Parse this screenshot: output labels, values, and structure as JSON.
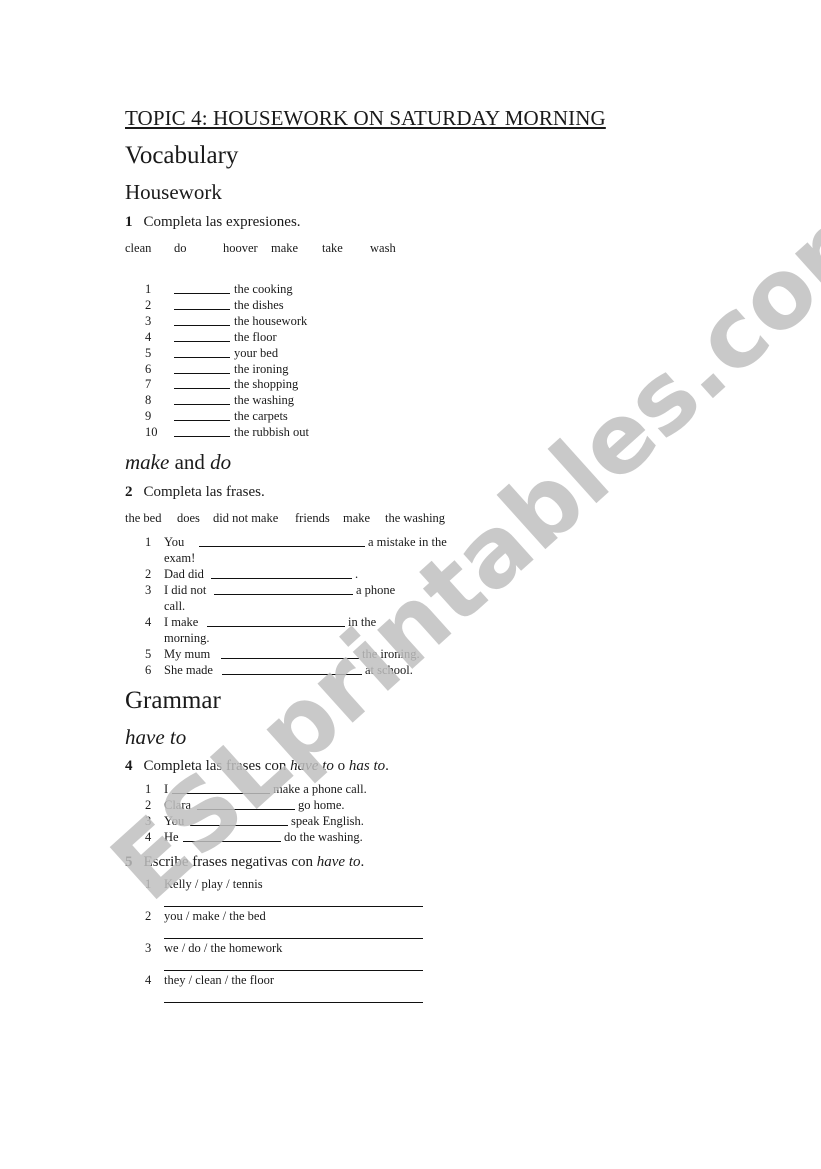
{
  "title": "TOPIC 4: HOUSEWORK ON SATURDAY MORNING",
  "watermark": {
    "text": "ESLprintables.com",
    "color": "#c0c0c0"
  },
  "vocabulary": {
    "heading": "Vocabulary",
    "subheading": "Housework",
    "exercise1": {
      "number": "1",
      "instruction": "Completa las expresiones.",
      "word_bank": [
        "clean",
        "do",
        "hoover",
        "make",
        "take",
        "wash"
      ],
      "items": [
        {
          "n": "1",
          "text": "the cooking"
        },
        {
          "n": "2",
          "text": "the dishes"
        },
        {
          "n": "3",
          "text": "the housework"
        },
        {
          "n": "4",
          "text": "the floor"
        },
        {
          "n": "5",
          "text": "your bed"
        },
        {
          "n": "6",
          "text": "the ironing"
        },
        {
          "n": "7",
          "text": "the shopping"
        },
        {
          "n": "8",
          "text": "the washing"
        },
        {
          "n": "9",
          "text": "the carpets"
        },
        {
          "n": "10",
          "text": "the rubbish out"
        }
      ]
    },
    "make_do": {
      "heading_italic_1": "make",
      "heading_mid": " and ",
      "heading_italic_2": "do"
    },
    "exercise2": {
      "number": "2",
      "instruction": "Completa las frases.",
      "word_bank": [
        "the bed",
        "does",
        "did not make",
        "friends",
        "make",
        "the washing"
      ],
      "items": [
        {
          "n": "1",
          "before": "You",
          "after": "a mistake in the",
          "wrap": "exam!"
        },
        {
          "n": "2",
          "before": "Dad did",
          "after": ".",
          "wrap": ""
        },
        {
          "n": "3",
          "before": "I did not",
          "after": "a phone",
          "wrap": "call."
        },
        {
          "n": "4",
          "before": "I make",
          "after": "in the",
          "wrap": "morning."
        },
        {
          "n": "5",
          "before": "My mum",
          "after": "the ironing.",
          "wrap": ""
        },
        {
          "n": "6",
          "before": "She made",
          "after": "at school.",
          "wrap": ""
        }
      ]
    }
  },
  "grammar": {
    "heading": "Grammar",
    "subheading": "have to",
    "exercise4": {
      "number": "4",
      "instruction_pre": "Completa las frases con ",
      "instruction_i1": "have to",
      "instruction_mid": " o ",
      "instruction_i2": "has to",
      "instruction_end": ".",
      "items": [
        {
          "n": "1",
          "before": "I",
          "after": "make a phone call."
        },
        {
          "n": "2",
          "before": "Clara",
          "after": "go home."
        },
        {
          "n": "3",
          "before": "You",
          "after": "speak English."
        },
        {
          "n": "4",
          "before": "He",
          "after": "do the washing."
        }
      ]
    },
    "exercise5": {
      "number": "5",
      "instruction_pre": "Escribe frases negativas con ",
      "instruction_i": "have to",
      "instruction_end": ".",
      "items": [
        {
          "n": "1",
          "prompt": "Kelly / play / tennis"
        },
        {
          "n": "2",
          "prompt": "you / make / the bed"
        },
        {
          "n": "3",
          "prompt": "we / do / the homework"
        },
        {
          "n": "4",
          "prompt": "they / clean / the floor"
        }
      ]
    }
  }
}
